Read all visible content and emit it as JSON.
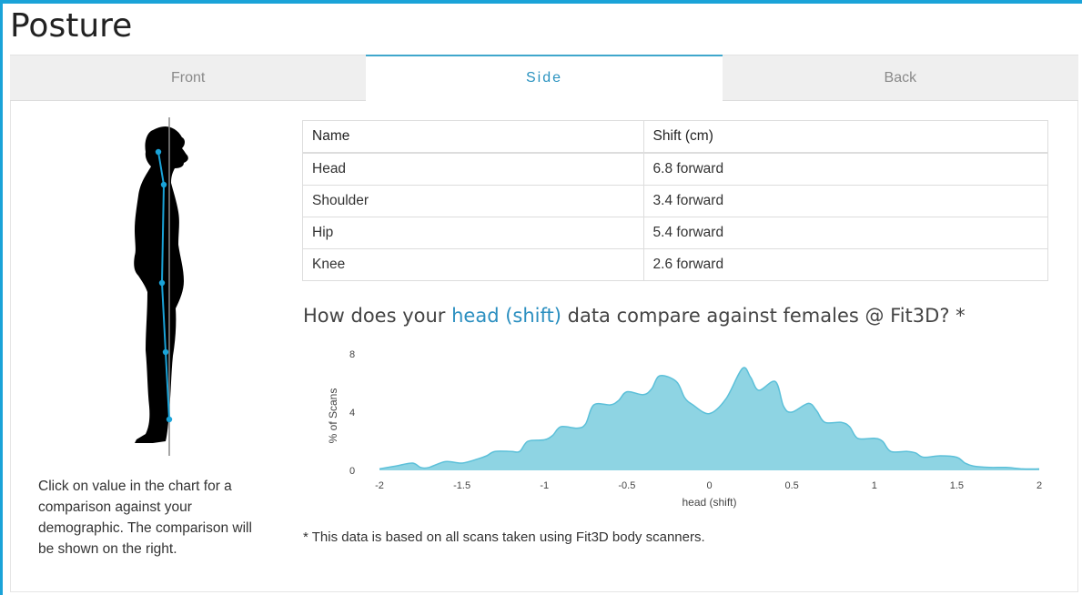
{
  "page": {
    "title": "Posture"
  },
  "tabs": [
    {
      "label": "Front",
      "active": false
    },
    {
      "label": "Side",
      "active": true
    },
    {
      "label": "Back",
      "active": false
    }
  ],
  "help_text": "Click on value in the chart for a comparison against your demographic. The comparison will be shown on the right.",
  "table": {
    "headers": [
      "Name",
      "Shift (cm)"
    ],
    "rows": [
      [
        "Head",
        "6.8 forward"
      ],
      [
        "Shoulder",
        "3.4 forward"
      ],
      [
        "Hip",
        "5.4 forward"
      ],
      [
        "Knee",
        "2.6 forward"
      ]
    ]
  },
  "question": {
    "prefix": "How does your ",
    "highlight": "head (shift)",
    "suffix": " data compare against females @ Fit3D? *"
  },
  "footnote": "* This data is based on all scans taken using Fit3D body scanners.",
  "colors": {
    "accent": "#1aa3d8",
    "fill": "#8ed4e3",
    "stroke": "#5cc0d9",
    "highlight": "#2b8fc0",
    "marker": "#1aa3d8"
  },
  "chart_data": {
    "type": "area",
    "xlabel": "head (shift)",
    "ylabel": "% of Scans",
    "xlim": [
      -2,
      2
    ],
    "ylim": [
      0,
      8
    ],
    "x_ticks": [
      -2,
      -1.5,
      -1,
      -0.5,
      0,
      0.5,
      1,
      1.5,
      2
    ],
    "y_ticks": [
      0,
      4,
      8
    ],
    "series": [
      {
        "x": [
          -2.0,
          -1.9,
          -1.8,
          -1.75,
          -1.7,
          -1.6,
          -1.5,
          -1.4,
          -1.35,
          -1.3,
          -1.2,
          -1.15,
          -1.1,
          -1.0,
          -0.95,
          -0.9,
          -0.8,
          -0.75,
          -0.7,
          -0.6,
          -0.55,
          -0.5,
          -0.4,
          -0.35,
          -0.3,
          -0.2,
          -0.15,
          -0.1,
          0.0,
          0.1,
          0.2,
          0.25,
          0.3,
          0.4,
          0.45,
          0.5,
          0.6,
          0.65,
          0.7,
          0.8,
          0.85,
          0.9,
          1.0,
          1.05,
          1.1,
          1.2,
          1.25,
          1.3,
          1.4,
          1.5,
          1.55,
          1.6,
          1.7,
          1.8,
          1.9,
          2.0
        ],
        "y": [
          0.1,
          0.3,
          0.5,
          0.2,
          0.2,
          0.6,
          0.5,
          0.8,
          1.0,
          1.3,
          1.3,
          1.3,
          2.0,
          2.1,
          2.4,
          3.0,
          2.9,
          3.2,
          4.5,
          4.5,
          4.8,
          5.4,
          5.2,
          5.6,
          6.5,
          6.1,
          5.0,
          4.5,
          3.9,
          4.9,
          7.0,
          6.4,
          5.5,
          6.1,
          4.4,
          4.0,
          4.6,
          4.1,
          3.3,
          3.3,
          3.0,
          2.2,
          2.2,
          2.0,
          1.3,
          1.3,
          1.2,
          0.9,
          1.0,
          0.9,
          0.5,
          0.3,
          0.2,
          0.2,
          0.1,
          0.1
        ]
      }
    ]
  }
}
